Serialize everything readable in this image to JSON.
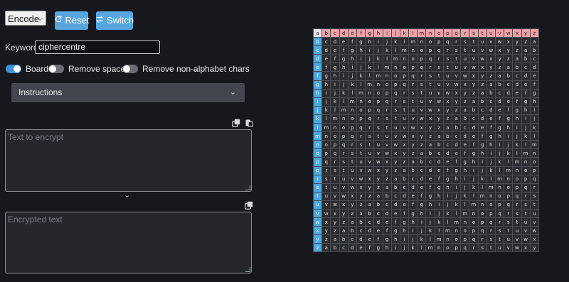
{
  "mode_select": {
    "value": "Encode"
  },
  "buttons": {
    "reset": "Reset",
    "switch": "Switch"
  },
  "keyword": {
    "label": "Keyword:",
    "value": "ciphercentre"
  },
  "toggles": {
    "board": {
      "label": "Board",
      "on": true
    },
    "remove_spaces": {
      "label": "Remove spaces",
      "on": false
    },
    "remove_non_alpha": {
      "label": "Remove non-alphabet chars",
      "on": false
    }
  },
  "instructions": {
    "label": "Instructions"
  },
  "input_area": {
    "placeholder": "Text to encrypt",
    "value": ""
  },
  "output_area": {
    "placeholder": "Encrypted text",
    "value": ""
  },
  "tabula": {
    "corner": "a",
    "alphabet": "abcdefghijklmnopqrstuvwxyz",
    "rows": [
      "bcdefghijklmnopqrstuvwxyza",
      "cdefghijklmnopqrstuvwxyzab",
      "defghijklmnopqrstuvwxyzabc",
      "efghijklmnopqrstuvwxyzabcd",
      "fghijklmnopqrstuvwxyzabcde",
      "ghijklmnopqrstuvwxyzabcdef",
      "hijklmnopqrstuvwxyzabcdefg",
      "ijklmnopqrstuvwxyzabcdefgh",
      "jklmnopqrstuvwxyzabcdefghi",
      "klmnopqrstuvwxyzabcdefghij",
      "lmnopqrstuvwxyzabcdefghijk",
      "mnopqrstuvwxyzabcdefghijkl",
      "nopqrstuvwxyzabcdefghijklm",
      "opqrstuvwxyzabcdefghijklmn",
      "pqrstuvwxyzabcdefghijklmno",
      "qrstuvwxyzabcdefghijklmnop",
      "rstuvwxyzabcdefghijklmnopq",
      "stuvwxyzabcdefghijklmnopqr",
      "tuvwxyzabcdefghijklmnopqrs",
      "uvwxyzabcdefghijklmnopqrst",
      "vwxyzabcdefghijklmnopqrstu",
      "wxyzabcdefghijklmnopqrstuv",
      "xyzabcdefghijklmnopqrstuvw",
      "yzabcdefghijklmnopqrstuvwx",
      "zabcdefghijklmnopqrstuvwxy"
    ]
  },
  "colors": {
    "background": "#16181d",
    "button": "#57a6df",
    "header_row": "#f0a0a6",
    "side_column": "#4aa7e0",
    "toggle_on": "#3d8fd6"
  }
}
